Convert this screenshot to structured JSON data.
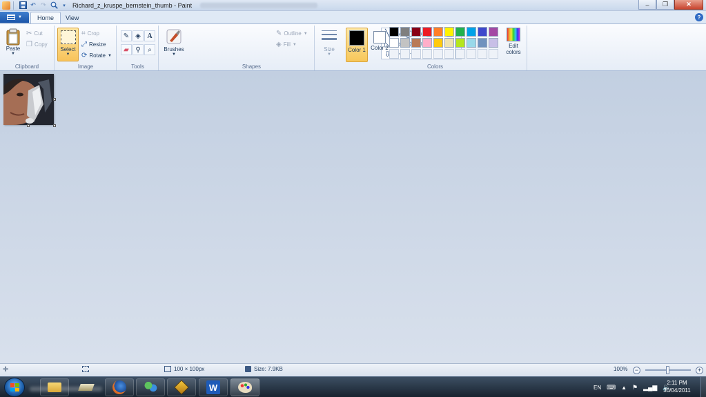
{
  "window": {
    "title": "Richard_z_kruspe_bernstein_thumb - Paint",
    "minimize": "–",
    "maximize": "❐",
    "close": "✕"
  },
  "tabs": {
    "home": "Home",
    "view": "View"
  },
  "help": "?",
  "ribbon": {
    "clipboard": {
      "label": "Clipboard",
      "paste": "Paste",
      "cut": "Cut",
      "copy": "Copy"
    },
    "image": {
      "label": "Image",
      "select": "Select",
      "crop": "Crop",
      "resize": "Resize",
      "rotate": "Rotate"
    },
    "tools": {
      "label": "Tools"
    },
    "brushes": {
      "label": "Brushes"
    },
    "shapes": {
      "label": "Shapes",
      "outline": "Outline",
      "fill": "Fill",
      "glyphs": [
        "╲",
        "∿",
        "◯",
        "▭",
        "▢",
        "◸",
        "△",
        "◺",
        "◇",
        "⬠",
        "⬡",
        "⇨",
        "⇦",
        "⇧",
        "⇩",
        "✧",
        "☆",
        "✡",
        "▭",
        "◯",
        "◌"
      ]
    },
    "size": {
      "label": "Size"
    },
    "colors": {
      "label": "Colors",
      "color1": "Color 1",
      "color2": "Color 2",
      "color1_value": "#000000",
      "color2_value": "#ffffff",
      "edit": "Edit colors",
      "palette": [
        "#000000",
        "#7f7f7f",
        "#880015",
        "#ed1c24",
        "#ff7f27",
        "#fff200",
        "#22b14c",
        "#00a2e8",
        "#3f48cc",
        "#a349a4",
        "#ffffff",
        "#c3c3c3",
        "#b97a57",
        "#ffaec9",
        "#ffc90e",
        "#efe4b0",
        "#b5e61d",
        "#99d9ea",
        "#7092be",
        "#c8bfe7"
      ]
    }
  },
  "status": {
    "dimensions": "100 × 100px",
    "size": "Size: 7.9KB",
    "zoom": "100%"
  },
  "taskbar": {
    "lang": "EN",
    "time": "2:11 PM",
    "date": "30/04/2011"
  }
}
